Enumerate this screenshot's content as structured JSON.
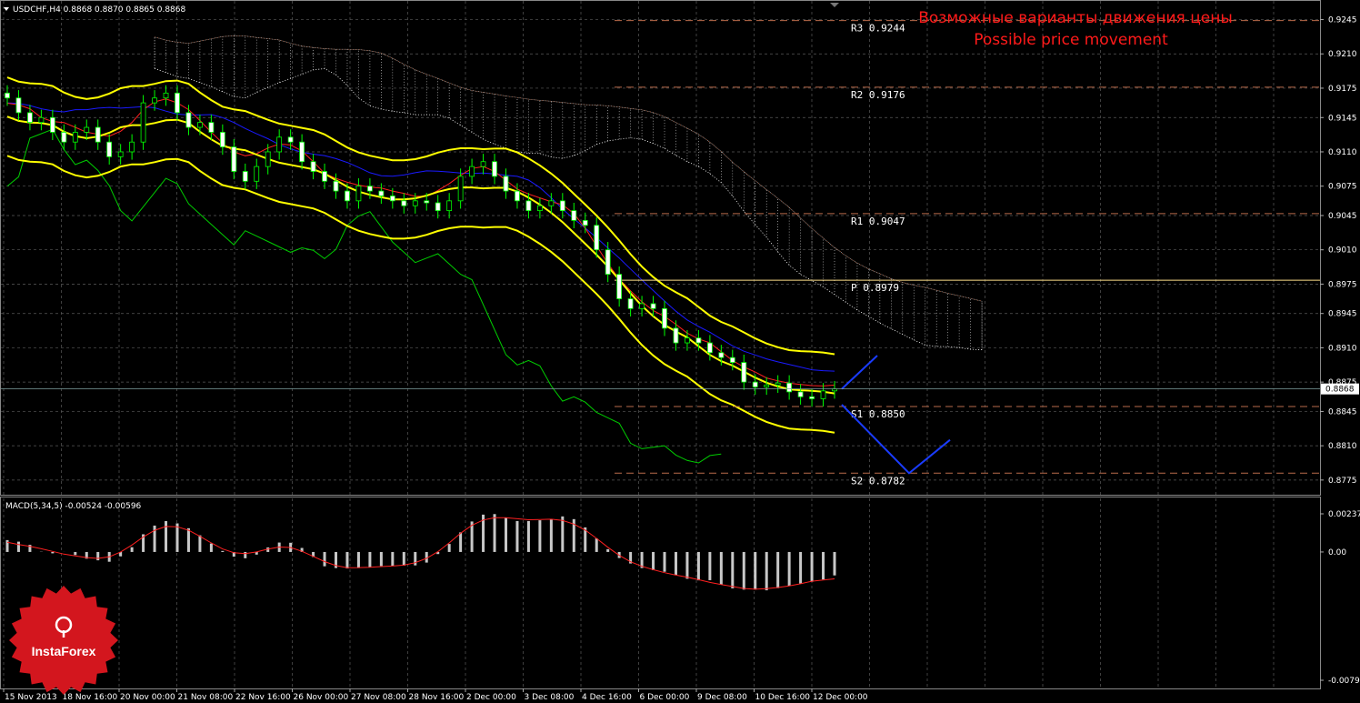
{
  "chart_data": [
    {
      "type": "line",
      "symbol": "USDCHF,H4",
      "ohlc": {
        "open": "0.8868",
        "high": "0.8870",
        "low": "0.8865",
        "close": "0.8868"
      },
      "ylim": [
        0.876,
        0.9265
      ],
      "y_ticks": [
        "0.9245",
        "0.9210",
        "0.9175",
        "0.9145",
        "0.9110",
        "0.9075",
        "0.9045",
        "0.9010",
        "0.8975",
        "0.8945",
        "0.8910",
        "0.8875",
        "0.8845",
        "0.8810",
        "0.8775"
      ],
      "current_price": "0.8868",
      "x_tick_labels": [
        "15 Nov 2013",
        "18 Nov 16:00",
        "20 Nov 00:00",
        "21 Nov 08:00",
        "22 Nov 16:00",
        "26 Nov 00:00",
        "27 Nov 08:00",
        "28 Nov 16:00",
        "2 Dec 00:00",
        "3 Dec 08:00",
        "4 Dec 16:00",
        "6 Dec 00:00",
        "9 Dec 08:00",
        "10 Dec 16:00",
        "12 Dec 00:00"
      ],
      "pivot_levels": [
        {
          "name": "R3",
          "value": "0.9244"
        },
        {
          "name": "R2",
          "value": "0.9176"
        },
        {
          "name": "R1",
          "value": "0.9047"
        },
        {
          "name": "P",
          "value": "0.8979"
        },
        {
          "name": "S1",
          "value": "0.8850"
        },
        {
          "name": "S2",
          "value": "0.8782"
        }
      ],
      "annotation_ru": "Возможные варианты движения цены",
      "annotation_en": "Possible price movement",
      "close_series": [
        0.9165,
        0.915,
        0.914,
        0.9145,
        0.913,
        0.912,
        0.913,
        0.9135,
        0.912,
        0.9105,
        0.911,
        0.912,
        0.916,
        0.9165,
        0.917,
        0.915,
        0.9135,
        0.914,
        0.913,
        0.9115,
        0.909,
        0.908,
        0.9095,
        0.911,
        0.9125,
        0.912,
        0.91,
        0.909,
        0.908,
        0.907,
        0.906,
        0.9075,
        0.907,
        0.9065,
        0.906,
        0.9055,
        0.906,
        0.9058,
        0.905,
        0.906,
        0.9085,
        0.9095,
        0.91,
        0.9085,
        0.907,
        0.906,
        0.905,
        0.9055,
        0.906,
        0.905,
        0.904,
        0.9035,
        0.901,
        0.8985,
        0.896,
        0.895,
        0.8955,
        0.895,
        0.893,
        0.8915,
        0.892,
        0.8915,
        0.8905,
        0.89,
        0.8895,
        0.8875,
        0.887,
        0.8872,
        0.8874,
        0.8865,
        0.886,
        0.8858,
        0.8866,
        0.8868
      ],
      "projection_up": [
        0.8868,
        0.8902
      ],
      "projection_down": [
        0.8852,
        0.8782,
        0.8816
      ]
    },
    {
      "type": "bar",
      "indicator": "MACD(5,34,5)",
      "values_label": "-0.00524 -0.00596",
      "ylim": [
        -0.00797,
        0.00237
      ],
      "y_ticks": [
        "0.00237",
        "0.00",
        "-0.00797"
      ]
    }
  ],
  "logo": {
    "name": "InstaForex",
    "icon": "instaforex-logo-icon"
  },
  "colors": {
    "bands": "#ffff00",
    "tenkan": "#ff2020",
    "kijun": "#1a1aff",
    "chikou": "#00cc00",
    "projection": "#1a3cff",
    "annotation": "#ff1a1a",
    "pivot": "#b86a4a",
    "logo": "#d3161e"
  }
}
